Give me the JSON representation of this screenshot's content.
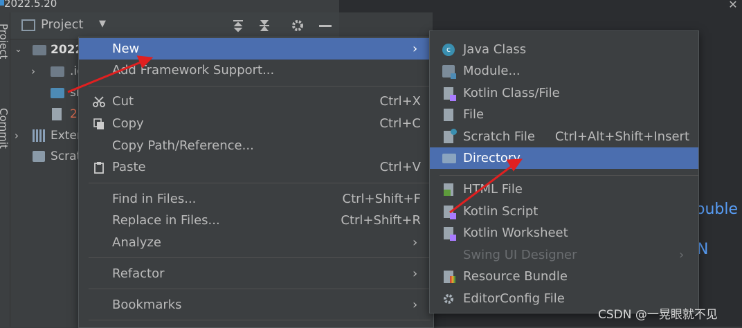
{
  "window": {
    "title": "2022.5.20",
    "close_glyph": "✕"
  },
  "toolstrip": {
    "project_label": "Project",
    "commit_label": "Commit"
  },
  "project_panel": {
    "header_label": "Project",
    "tree": [
      {
        "label": "2022",
        "bold": true
      },
      {
        "label": ".id"
      },
      {
        "label": "sr"
      },
      {
        "label": "2"
      },
      {
        "label": "Exter"
      },
      {
        "label": "Scrat"
      }
    ]
  },
  "editor": {
    "frag1": "ouble",
    "frag2": "N"
  },
  "context_menu": {
    "items": [
      {
        "label": "New",
        "submenu": true
      },
      {
        "label": "Add Framework Support..."
      },
      {
        "label": "Cut",
        "shortcut": "Ctrl+X",
        "icon": "cut-icon"
      },
      {
        "label": "Copy",
        "shortcut": "Ctrl+C",
        "icon": "copy-icon"
      },
      {
        "label": "Copy Path/Reference..."
      },
      {
        "label": "Paste",
        "shortcut": "Ctrl+V",
        "icon": "paste-icon"
      },
      {
        "label": "Find in Files...",
        "shortcut": "Ctrl+Shift+F"
      },
      {
        "label": "Replace in Files...",
        "shortcut": "Ctrl+Shift+R"
      },
      {
        "label": "Analyze",
        "submenu": true
      },
      {
        "label": "Refactor",
        "submenu": true
      },
      {
        "label": "Bookmarks",
        "submenu": true
      }
    ]
  },
  "new_submenu": {
    "items": [
      {
        "label": "Java Class",
        "icon": "java-class-icon"
      },
      {
        "label": "Module...",
        "icon": "module-icon"
      },
      {
        "label": "Kotlin Class/File",
        "icon": "kotlin-class-icon"
      },
      {
        "label": "File",
        "icon": "file-icon"
      },
      {
        "label": "Scratch File",
        "shortcut": "Ctrl+Alt+Shift+Insert",
        "icon": "scratch-file-icon"
      },
      {
        "label": "Directory",
        "icon": "directory-icon"
      },
      {
        "label": "HTML File",
        "icon": "html-file-icon"
      },
      {
        "label": "Kotlin Script",
        "icon": "kotlin-script-icon"
      },
      {
        "label": "Kotlin Worksheet",
        "icon": "kotlin-worksheet-icon"
      },
      {
        "label": "Swing UI Designer",
        "icon": "swing-ui-icon",
        "disabled": true,
        "submenu": true
      },
      {
        "label": "Resource Bundle",
        "icon": "resource-bundle-icon"
      },
      {
        "label": "EditorConfig File",
        "icon": "editorconfig-icon"
      }
    ]
  },
  "watermark": "CSDN @一晃眼就不见",
  "colors": {
    "selection": "#4b6eaf",
    "arrow": "#e02020",
    "link_blue": "#589df6"
  }
}
